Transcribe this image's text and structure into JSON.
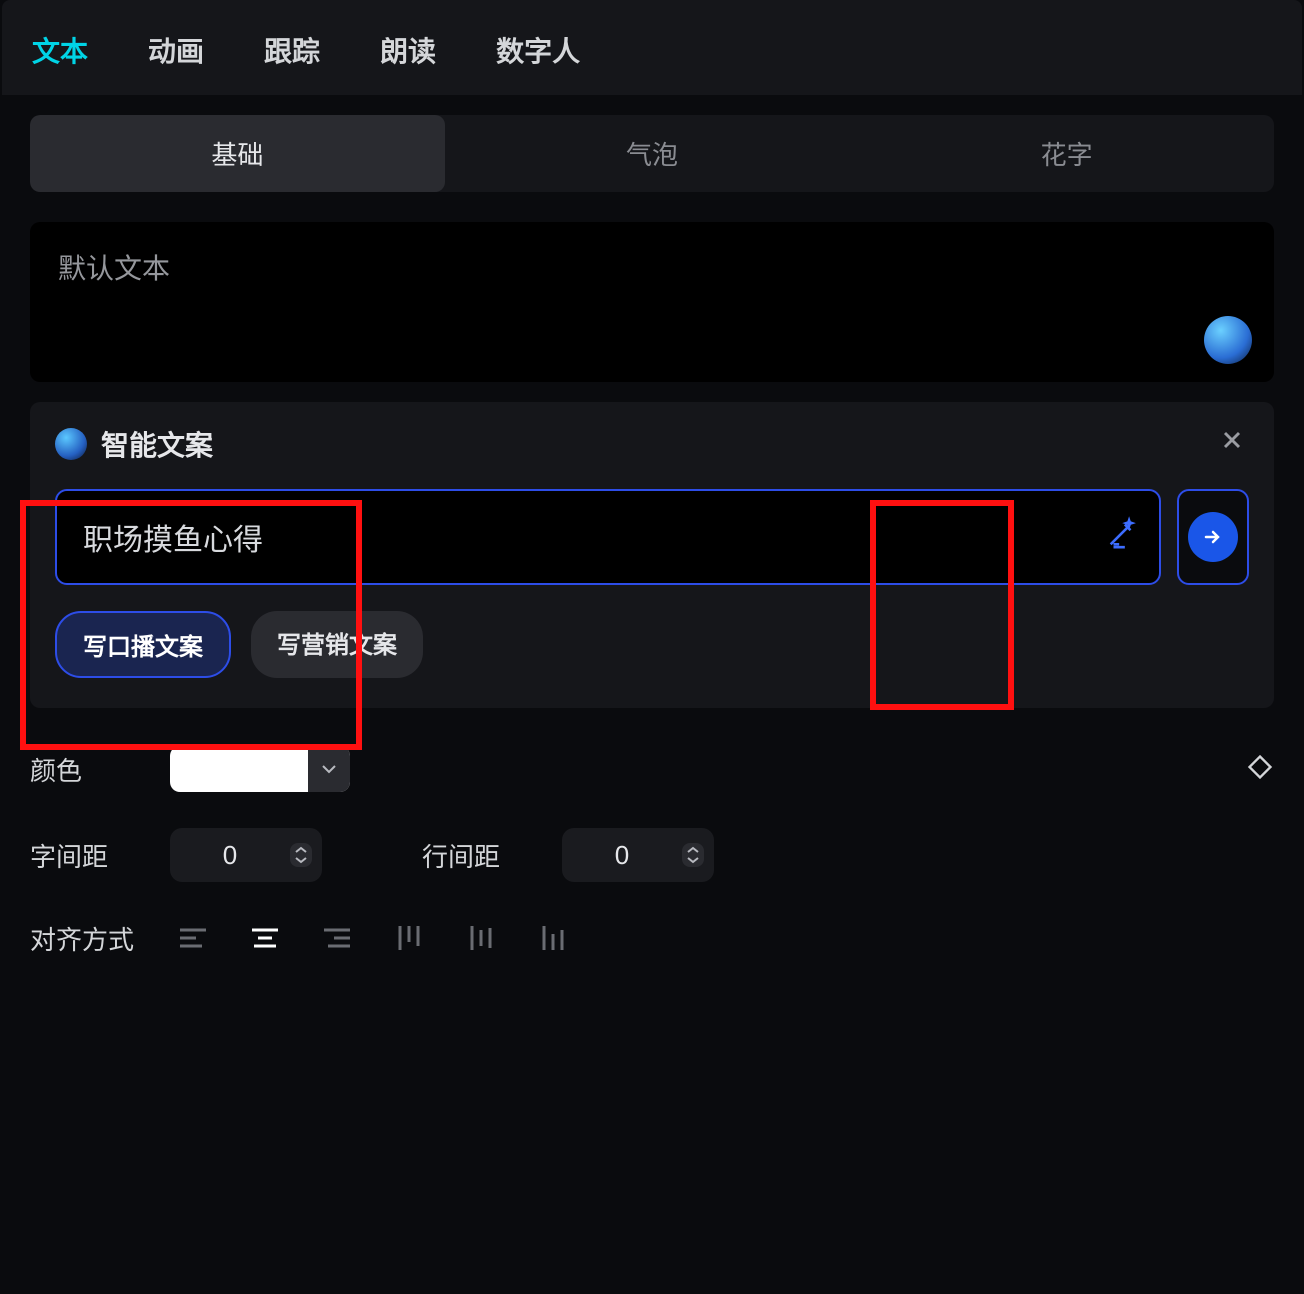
{
  "topTabs": {
    "items": [
      "文本",
      "动画",
      "跟踪",
      "朗读",
      "数字人"
    ],
    "activeIndex": 0
  },
  "subTabs": {
    "items": [
      "基础",
      "气泡",
      "花字"
    ],
    "activeIndex": 0
  },
  "textBox": {
    "placeholder": "默认文本"
  },
  "aiPanel": {
    "title": "智能文案",
    "inputValue": "职场摸鱼心得",
    "chips": [
      "写口播文案",
      "写营销文案"
    ]
  },
  "controls": {
    "colorLabel": "颜色",
    "letterSpacingLabel": "字间距",
    "letterSpacingValue": "0",
    "lineSpacingLabel": "行间距",
    "lineSpacingValue": "0",
    "alignLabel": "对齐方式"
  }
}
